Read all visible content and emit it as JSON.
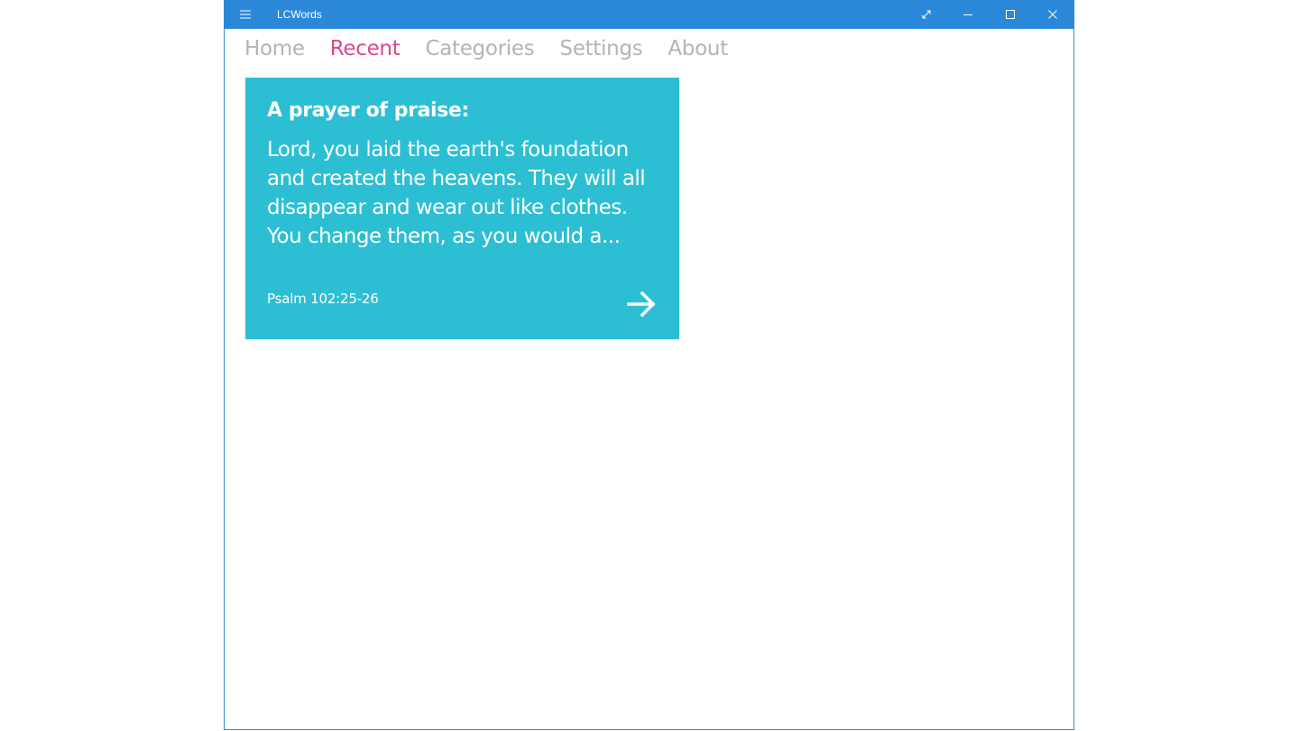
{
  "window": {
    "title": "LCWords",
    "accent_color": "#2b88d8"
  },
  "nav": {
    "tabs": [
      {
        "label": "Home",
        "active": false
      },
      {
        "label": "Recent",
        "active": true
      },
      {
        "label": "Categories",
        "active": false
      },
      {
        "label": "Settings",
        "active": false
      },
      {
        "label": "About",
        "active": false
      }
    ],
    "active_color": "#e0468c",
    "inactive_color": "#b4b4b4"
  },
  "card": {
    "title": "A prayer of praise:",
    "body": "Lord, you laid the earth's foundation and created the heavens. They will all disappear and wear out like clothes. You change them, as you would a...",
    "reference": "Psalm 102:25-26",
    "background_color": "#2cbfd4",
    "action_icon": "arrow-right-icon"
  }
}
